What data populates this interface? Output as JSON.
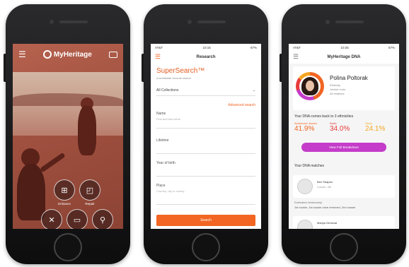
{
  "phones": {
    "photo": {
      "app_logo": "MyHeritage",
      "tools": {
        "enhance": "Enhance",
        "repair": "Repair"
      }
    },
    "research": {
      "status": {
        "carrier": "AT&T",
        "time": "10:15",
        "battery": "67%"
      },
      "nav_title": "Research",
      "brand": "SuperSearch™",
      "brand_sub": "A worldwide records search",
      "collection_select": "All Collections",
      "advanced_link": "Advanced search",
      "fields": {
        "name_label": "Name",
        "name_placeholder": "First and last name",
        "lifetime_label": "Lifetime",
        "year_birth_label": "Year of birth",
        "place_label": "Place",
        "place_placeholder": "Country, city or county"
      },
      "search_button": "Search"
    },
    "dna": {
      "status": {
        "carrier": "AT&T",
        "time": "10:25",
        "battery": "67%"
      },
      "nav_title": "MyHeritage DNA",
      "profile": {
        "name": "Polina Poltorak",
        "meta": [
          "Ethnicity",
          "Jewish roots",
          "All relatives"
        ]
      },
      "ethnicity_title": "Your DNA comes back to 3 ethnicities",
      "ethnicities": [
        {
          "label": "Ashkenazi Jewish",
          "value": "41.9%"
        },
        {
          "label": "Baltic",
          "value": "34.0%"
        },
        {
          "label": "Other",
          "value": "24.1%"
        }
      ],
      "full_button": "View Full Breakdown",
      "matches_title": "Your DNA matches",
      "match": {
        "name": "Ben Shapiro",
        "sub": "Cousin, 4th"
      },
      "relationship": "Estimated relationship",
      "relationship_value": "1st cousin, 1st cousin once removed, 2nd cousin",
      "match2_name": "Mariya Grinevat"
    }
  },
  "colors": {
    "accent_orange": "#f26522",
    "dna_purple": "#c43cc9",
    "photo_tint": "#a0503f"
  }
}
